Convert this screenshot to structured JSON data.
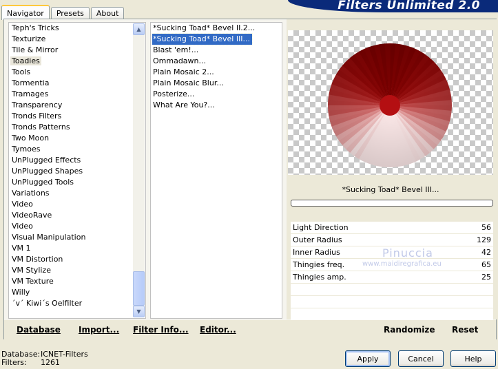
{
  "app": {
    "title": "Filters Unlimited 2.0"
  },
  "tabs": [
    {
      "label": "Navigator",
      "active": true
    },
    {
      "label": "Presets",
      "active": false
    },
    {
      "label": "About",
      "active": false
    }
  ],
  "categories": [
    {
      "label": "Teph's Tricks"
    },
    {
      "label": "Texturize"
    },
    {
      "label": "Tile & Mirror"
    },
    {
      "label": "Toadies",
      "selected": true
    },
    {
      "label": "Tools"
    },
    {
      "label": "Tormentia"
    },
    {
      "label": "Tramages"
    },
    {
      "label": "Transparency"
    },
    {
      "label": "Tronds Filters"
    },
    {
      "label": "Tronds Patterns"
    },
    {
      "label": "Two Moon"
    },
    {
      "label": "Tymoes"
    },
    {
      "label": "UnPlugged Effects"
    },
    {
      "label": "UnPlugged Shapes"
    },
    {
      "label": "UnPlugged Tools"
    },
    {
      "label": "Variations"
    },
    {
      "label": "Video"
    },
    {
      "label": "VideoRave"
    },
    {
      "label": "Video"
    },
    {
      "label": "Visual Manipulation"
    },
    {
      "label": "VM 1"
    },
    {
      "label": "VM Distortion"
    },
    {
      "label": "VM Stylize"
    },
    {
      "label": "VM Texture"
    },
    {
      "label": "Willy"
    },
    {
      "label": "´v´ Kiwi´s Oelfilter"
    }
  ],
  "filters": [
    {
      "label": "*Sucking Toad*  Bevel II.2..."
    },
    {
      "label": "*Sucking Toad*  Bevel III...",
      "selected": true
    },
    {
      "label": "Blast 'em!..."
    },
    {
      "label": "Ommadawn..."
    },
    {
      "label": "Plain Mosaic 2..."
    },
    {
      "label": "Plain Mosaic Blur..."
    },
    {
      "label": "Posterize..."
    },
    {
      "label": "What Are You?..."
    }
  ],
  "preview": {
    "filter_name": "*Sucking Toad*  Bevel III..."
  },
  "parameters": [
    {
      "name": "Light Direction",
      "value": "56"
    },
    {
      "name": "Outer Radius",
      "value": "129"
    },
    {
      "name": "Inner Radius",
      "value": "42"
    },
    {
      "name": "Thingies freq.",
      "value": "65"
    },
    {
      "name": "Thingies amp.",
      "value": "25"
    }
  ],
  "watermark": {
    "line1": "Pinuccia",
    "line2": "www.maidiregrafica.eu"
  },
  "toolbar": {
    "database": "Database",
    "import": "Import...",
    "filter_info": "Filter Info...",
    "editor": "Editor...",
    "randomize": "Randomize",
    "reset": "Reset"
  },
  "status": {
    "database_label": "Database:",
    "database_value": "ICNET-Filters",
    "filters_label": "Filters:",
    "filters_value": "1261"
  },
  "dialog": {
    "apply": "Apply",
    "cancel": "Cancel",
    "help": "Help"
  },
  "colors": {
    "selection": "#316ac5",
    "banner": "#0a2a7a",
    "disc_center": "#b40f12"
  }
}
